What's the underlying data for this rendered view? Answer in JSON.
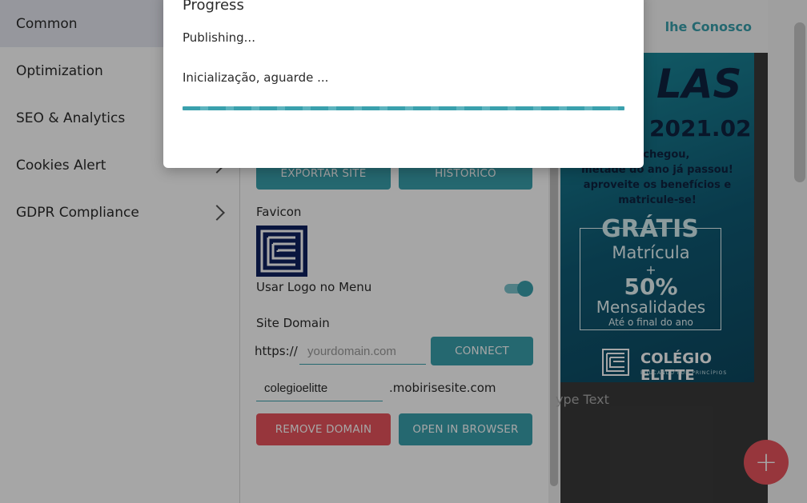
{
  "sidebar": {
    "items": [
      {
        "label": "Common",
        "active": true,
        "chevron": false
      },
      {
        "label": "Optimization",
        "chevron": false
      },
      {
        "label": "SEO & Analytics",
        "chevron": false
      },
      {
        "label": "Cookies Alert",
        "chevron": true
      },
      {
        "label": "GDPR Compliance",
        "chevron": true
      }
    ]
  },
  "panel": {
    "export_button": "EXPORTAR SITE",
    "history_button": "HISTÓRICO",
    "favicon_label": "Favicon",
    "use_logo_label": "Usar Logo no Menu",
    "use_logo_enabled": true,
    "site_domain_label": "Site Domain",
    "https_prefix": "https://",
    "domain_placeholder": "yourdomain.com",
    "connect_button": "CONNECT",
    "subdomain_value": "colegioelitte",
    "subdomain_suffix": ".mobirisesite.com",
    "remove_domain_button": "REMOVE DOMAIN",
    "open_browser_button": "OPEN IN BROWSER"
  },
  "preview": {
    "nav_link": "lhe Conosco",
    "banner": {
      "headline_fragment": "LAS",
      "year": "2021.02",
      "copy_lines": [
        "ho chegou,",
        "metade do ano já passou!",
        "aproveite os benefícios e",
        "matricule-se!"
      ],
      "offer_title": "GRÁTIS",
      "offer_item1": "Matrícula",
      "offer_plus": "+",
      "offer_percent": "50%",
      "offer_item2": "Mensalidades",
      "offer_note": "Até o final do ano",
      "logo_text": "COLÉGIO ELITTE",
      "logo_tagline": "EDUCANDO POR PRINCÍPIOS"
    },
    "type_text": "ype Text",
    "fab_icon": "plus-icon"
  },
  "dialog": {
    "title": "Progress",
    "message": "Publishing...",
    "status": "Inicialização, aguarde ...",
    "progress": 1.0
  },
  "colors": {
    "accent": "#3aa0ad",
    "danger": "#e9545c",
    "favicon_bg": "#0f2160"
  }
}
